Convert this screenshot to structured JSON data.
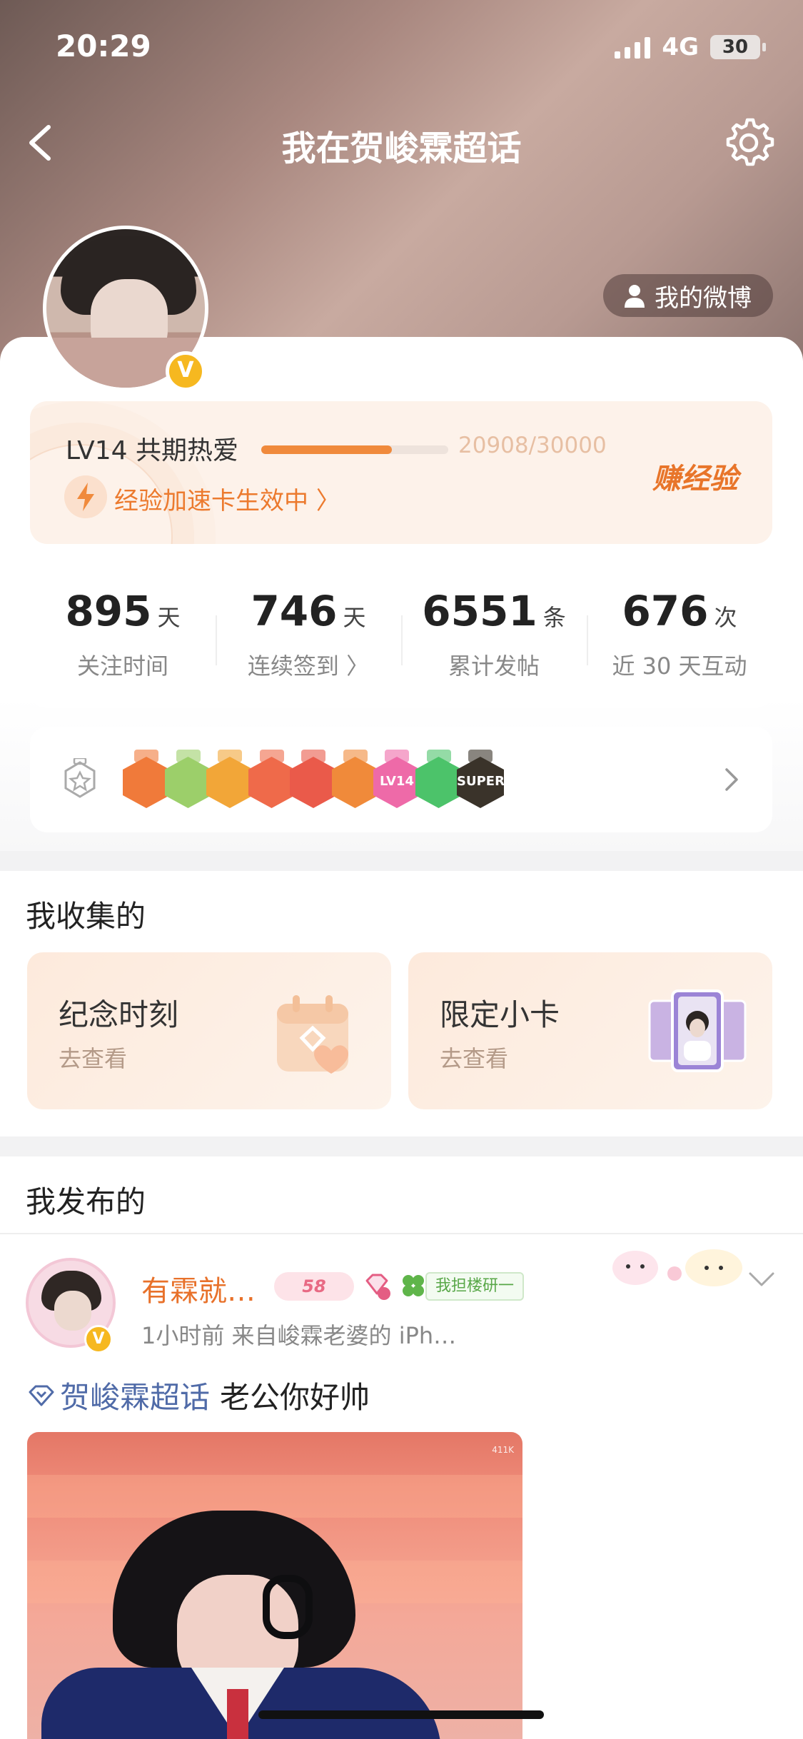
{
  "status_bar": {
    "time": "20:29",
    "network": "4G",
    "battery": "30"
  },
  "nav": {
    "title": "我在贺峻霖超话"
  },
  "profile": {
    "verified_badge": "V",
    "weibo_button": "我的微博"
  },
  "level": {
    "label": "LV14 共期热爱",
    "exp_text": "20908/30000",
    "progress_fraction": 0.697,
    "boost_text": "经验加速卡生效中 〉",
    "earn_label": "赚经验"
  },
  "stats": [
    {
      "value": "895",
      "unit": "天",
      "label": "关注时间"
    },
    {
      "value": "746",
      "unit": "天",
      "label": "连续签到 〉"
    },
    {
      "value": "6551",
      "unit": "条",
      "label": "累计发帖"
    },
    {
      "value": "676",
      "unit": "次",
      "label": "近 30 天互动"
    }
  ],
  "badges": {
    "items": [
      {
        "icon": "hand-badge-icon",
        "color": "#f07a3a",
        "text": ""
      },
      {
        "icon": "plant-badge-icon",
        "color": "#9ccf6a",
        "text": ""
      },
      {
        "icon": "crown-badge-icon",
        "color": "#f2a638",
        "text": ""
      },
      {
        "icon": "cat-badge-icon",
        "color": "#ef6a4a",
        "text": ""
      },
      {
        "icon": "cat-badge-icon",
        "color": "#ea5a4a",
        "text": ""
      },
      {
        "icon": "cat-badge-icon",
        "color": "#f08a3a",
        "text": ""
      },
      {
        "icon": "lv14-badge-icon",
        "color": "#ee6aa8",
        "text": "LV14"
      },
      {
        "icon": "hand-green-badge-icon",
        "color": "#4cc36a",
        "text": ""
      },
      {
        "icon": "super-badge-icon",
        "color": "#3a332a",
        "text": "SUPER"
      }
    ]
  },
  "collected": {
    "title": "我收集的",
    "cards": [
      {
        "title": "纪念时刻",
        "sub": "去查看"
      },
      {
        "title": "限定小卡",
        "sub": "去查看"
      }
    ]
  },
  "published": {
    "title": "我发布的",
    "post": {
      "author": "有霖就…",
      "level_badge": "58",
      "fan_tag": "我担楼研一",
      "meta": "1小时前   来自峻霖老婆的 iPh…",
      "topic": "贺峻霖超话",
      "text": "老公你好帅",
      "image_overlay_text": "411K"
    }
  },
  "colors": {
    "accent": "#ee7a2e",
    "link": "#506ba8",
    "verified": "#f6b820"
  }
}
